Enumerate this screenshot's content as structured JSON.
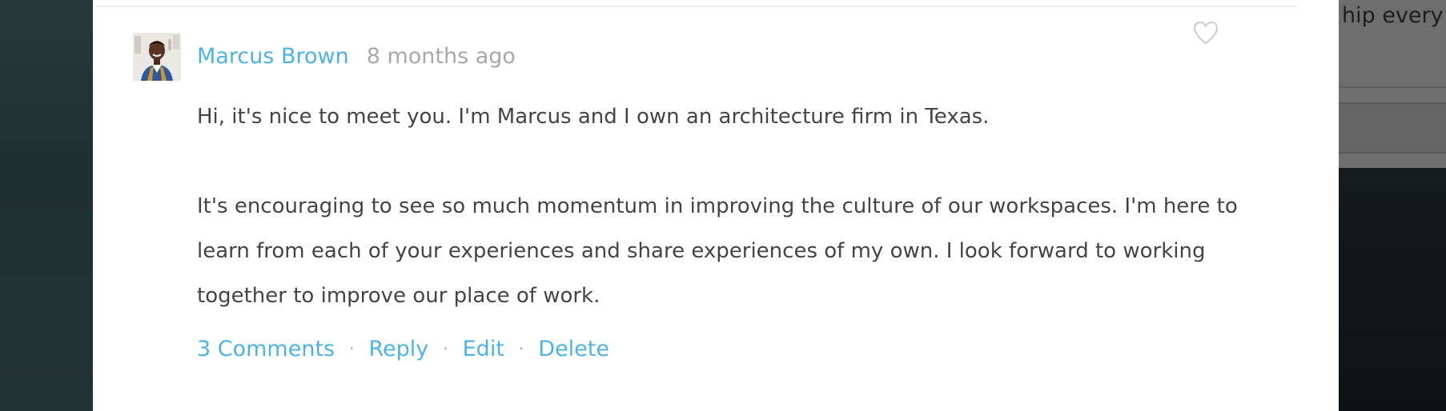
{
  "background": {
    "right_partial_text": "hip every c"
  },
  "comment": {
    "author": "Marcus Brown",
    "timestamp": "8 months ago",
    "avatar": "person-photo-avatar",
    "like_icon": "heart-outline-icon",
    "paragraphs": [
      "Hi, it's nice to meet you. I'm Marcus and I own an architecture firm in Texas.",
      "It's encouraging to see so much momentum in improving the culture of our workspaces. I'm here to",
      "learn from each of your experiences and share experiences of my own. I look forward to working",
      "together to improve our place of work."
    ],
    "actions": {
      "comments": "3 Comments",
      "reply": "Reply",
      "edit": "Edit",
      "delete": "Delete",
      "separator": "·"
    }
  },
  "colors": {
    "link": "#4cb3e6",
    "muted": "#a8a8a8",
    "text": "#444444"
  }
}
